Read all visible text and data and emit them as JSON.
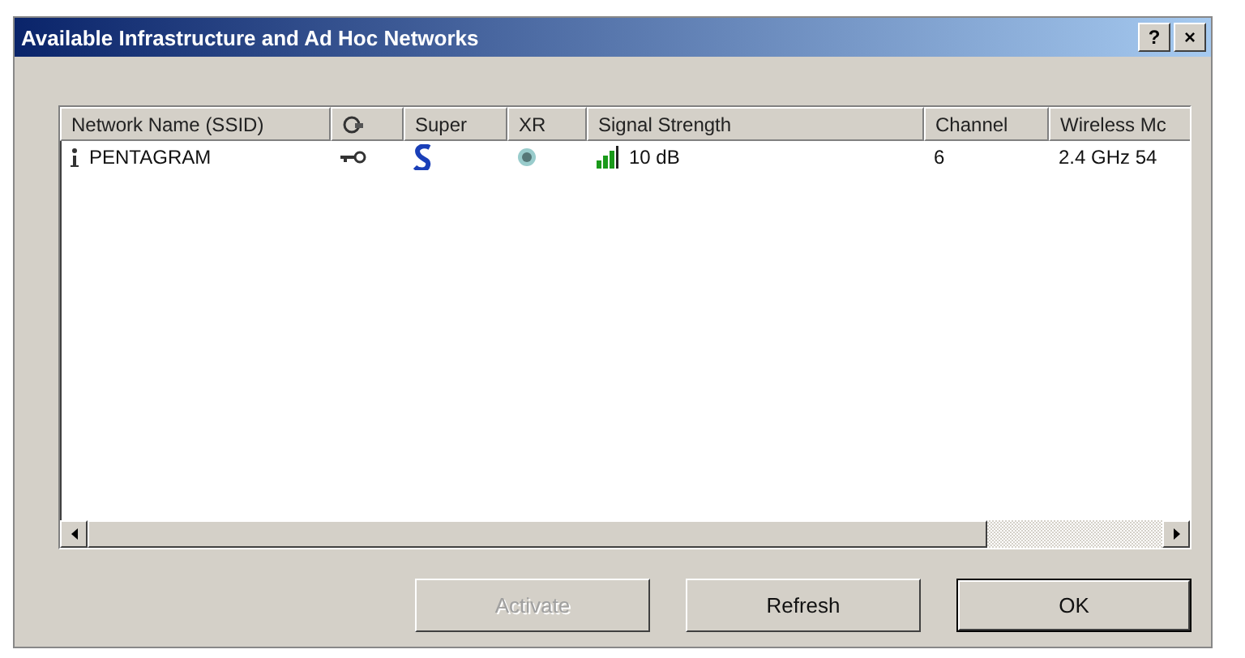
{
  "window": {
    "title": "Available Infrastructure and Ad Hoc Networks",
    "controls": [
      "?",
      "×"
    ]
  },
  "table": {
    "columns": [
      {
        "kind": "text",
        "label": "Network Name (SSID)"
      },
      {
        "kind": "icon"
      },
      {
        "kind": "text",
        "label": "Super"
      },
      {
        "kind": "text",
        "label": "XR"
      },
      {
        "kind": "text",
        "label": "Signal Strength"
      },
      {
        "kind": "text",
        "label": "Channel"
      },
      {
        "kind": "text",
        "label": "Wireless Mc"
      }
    ],
    "rows": [
      {
        "ssid": "PENTAGRAM",
        "signal": "10 dB",
        "channel": "6",
        "wireless_mode": "2.4 GHz 54"
      }
    ]
  },
  "buttons": [
    {
      "label": "Activate",
      "disabled": true,
      "default": false
    },
    {
      "label": "Refresh",
      "disabled": false,
      "default": false
    },
    {
      "label": "OK",
      "disabled": false,
      "default": true
    }
  ]
}
